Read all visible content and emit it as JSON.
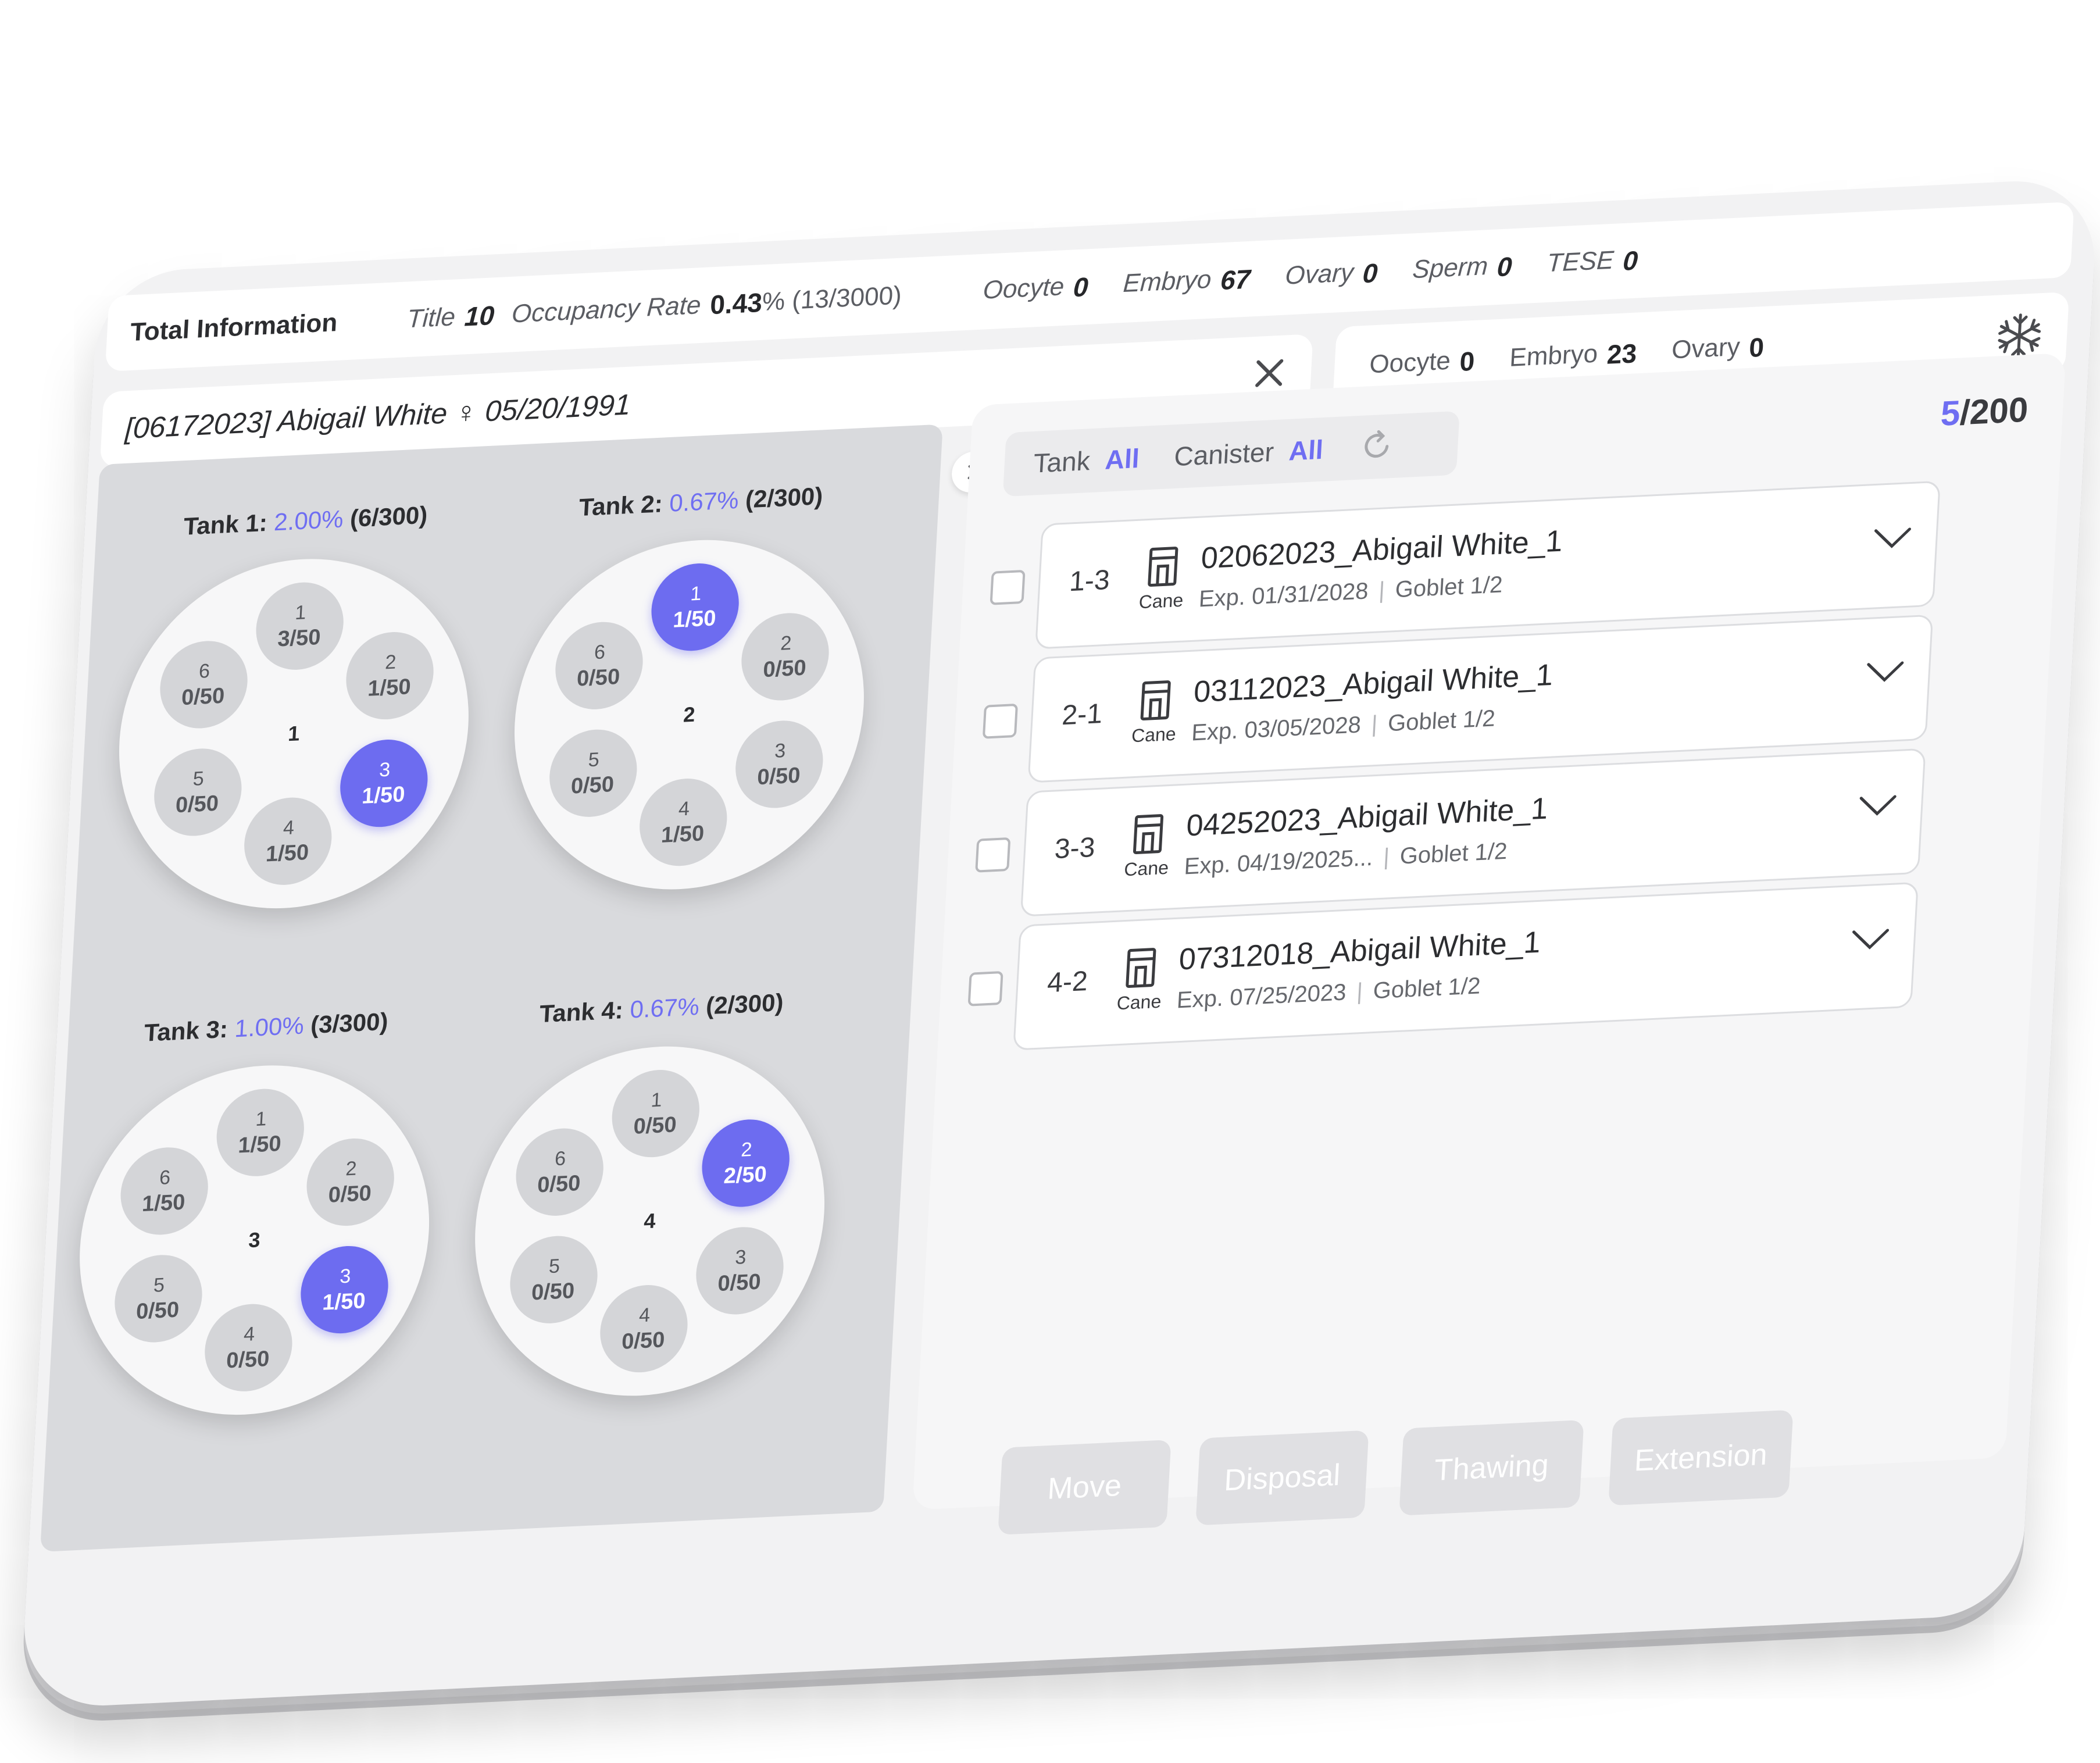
{
  "total_info": {
    "label": "Total Information",
    "title_label": "Title",
    "title_value": "10",
    "occupancy_label": "Occupancy Rate",
    "occupancy_value": "0.43",
    "occupancy_detail": "% (13/3000)",
    "counts": [
      {
        "label": "Oocyte",
        "value": "0"
      },
      {
        "label": "Embryo",
        "value": "67"
      },
      {
        "label": "Ovary",
        "value": "0"
      },
      {
        "label": "Sperm",
        "value": "0"
      },
      {
        "label": "TESE",
        "value": "0"
      }
    ]
  },
  "patient": {
    "header": "[06172023] Abigail White ♀ 05/20/1991",
    "counts": [
      {
        "label": "Oocyte",
        "value": "0"
      },
      {
        "label": "Embryo",
        "value": "23"
      },
      {
        "label": "Ovary",
        "value": "0"
      }
    ]
  },
  "tanks": [
    {
      "name": "Tank 1:",
      "rate": "2.00%",
      "detail": "(6/300)",
      "center": "1",
      "slots": [
        {
          "n": "1",
          "c": "3/50",
          "active": false
        },
        {
          "n": "2",
          "c": "1/50",
          "active": false
        },
        {
          "n": "3",
          "c": "1/50",
          "active": true
        },
        {
          "n": "4",
          "c": "1/50",
          "active": false
        },
        {
          "n": "5",
          "c": "0/50",
          "active": false
        },
        {
          "n": "6",
          "c": "0/50",
          "active": false
        }
      ]
    },
    {
      "name": "Tank 2:",
      "rate": "0.67%",
      "detail": "(2/300)",
      "center": "2",
      "slots": [
        {
          "n": "1",
          "c": "1/50",
          "active": true
        },
        {
          "n": "2",
          "c": "0/50",
          "active": false
        },
        {
          "n": "3",
          "c": "0/50",
          "active": false
        },
        {
          "n": "4",
          "c": "1/50",
          "active": false
        },
        {
          "n": "5",
          "c": "0/50",
          "active": false
        },
        {
          "n": "6",
          "c": "0/50",
          "active": false
        }
      ]
    },
    {
      "name": "Tank 3:",
      "rate": "1.00%",
      "detail": "(3/300)",
      "center": "3",
      "slots": [
        {
          "n": "1",
          "c": "1/50",
          "active": false
        },
        {
          "n": "2",
          "c": "0/50",
          "active": false
        },
        {
          "n": "3",
          "c": "1/50",
          "active": true
        },
        {
          "n": "4",
          "c": "0/50",
          "active": false
        },
        {
          "n": "5",
          "c": "0/50",
          "active": false
        },
        {
          "n": "6",
          "c": "1/50",
          "active": false
        }
      ]
    },
    {
      "name": "Tank 4:",
      "rate": "0.67%",
      "detail": "(2/300)",
      "center": "4",
      "slots": [
        {
          "n": "1",
          "c": "0/50",
          "active": false
        },
        {
          "n": "2",
          "c": "2/50",
          "active": true
        },
        {
          "n": "3",
          "c": "0/50",
          "active": false
        },
        {
          "n": "4",
          "c": "0/50",
          "active": false
        },
        {
          "n": "5",
          "c": "0/50",
          "active": false
        },
        {
          "n": "6",
          "c": "0/50",
          "active": false
        }
      ]
    }
  ],
  "filter": {
    "tank_label": "Tank",
    "tank_value": "All",
    "canister_label": "Canister",
    "canister_value": "All"
  },
  "pager": {
    "current": "5",
    "total": "/200"
  },
  "records": [
    {
      "pos": "1-3",
      "type": "Cane",
      "name": "02062023_Abigail White_1",
      "exp": "Exp. 01/31/2028",
      "goblet": "Goblet 1/2"
    },
    {
      "pos": "2-1",
      "type": "Cane",
      "name": "03112023_Abigail White_1",
      "exp": "Exp. 03/05/2028",
      "goblet": "Goblet 1/2"
    },
    {
      "pos": "3-3",
      "type": "Cane",
      "name": "04252023_Abigail White_1",
      "exp": "Exp. 04/19/2025...",
      "goblet": "Goblet 1/2"
    },
    {
      "pos": "4-2",
      "type": "Cane",
      "name": "07312018_Abigail White_1",
      "exp": "Exp. 07/25/2023",
      "goblet": "Goblet 1/2"
    }
  ],
  "actions": [
    "Move",
    "Disposal",
    "Thawing",
    "Extension"
  ],
  "colors": {
    "accent": "#6d6cf0",
    "panel": "#d9dadd",
    "disabled": "#e0e0e3"
  }
}
